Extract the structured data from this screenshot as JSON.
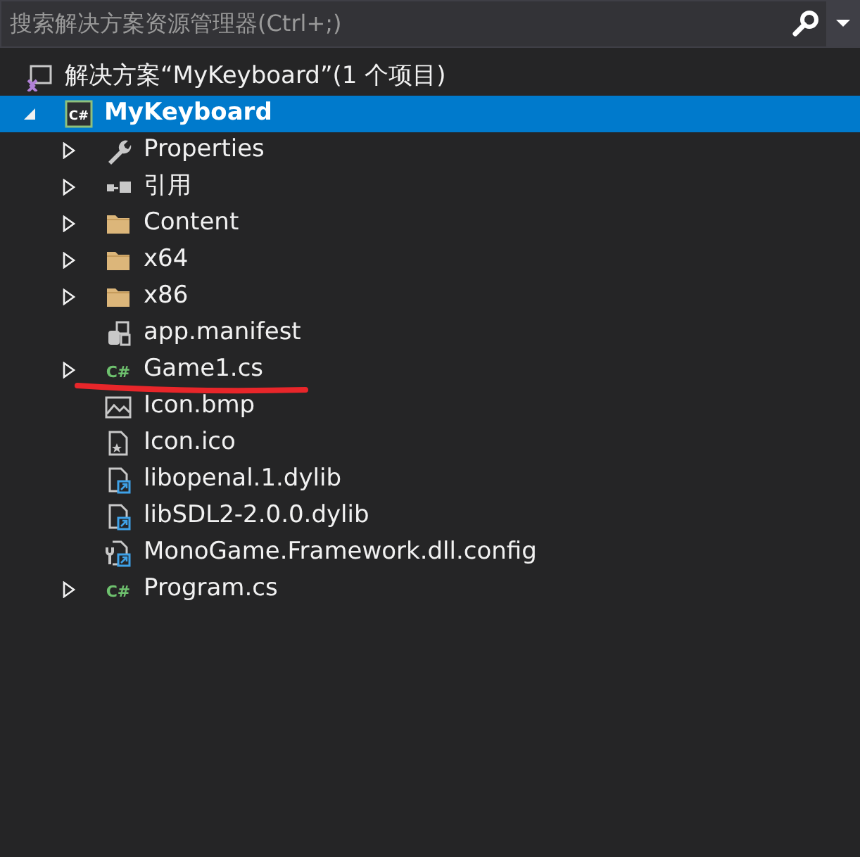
{
  "search": {
    "placeholder": "搜索解决方案资源管理器(Ctrl+;)"
  },
  "tree": [
    {
      "label": "解决方案“MyKeyboard”(1 个项目)",
      "kind": "solution",
      "selected": false,
      "children": [
        {
          "label": "MyKeyboard",
          "kind": "csproj",
          "icon_text": "C#",
          "expanded": true,
          "selected": true,
          "children": [
            {
              "label": "Properties",
              "kind": "wrench",
              "expanded": false,
              "selected": false
            },
            {
              "label": "引用",
              "kind": "reference",
              "expanded": false,
              "selected": false
            },
            {
              "label": "Content",
              "kind": "folder",
              "expanded": false,
              "selected": false
            },
            {
              "label": "x64",
              "kind": "folder",
              "expanded": false,
              "selected": false
            },
            {
              "label": "x86",
              "kind": "folder",
              "expanded": false,
              "selected": false
            },
            {
              "label": "app.manifest",
              "kind": "manifest",
              "selected": false
            },
            {
              "label": "Game1.cs",
              "kind": "csharp",
              "icon_text": "C#",
              "expanded": false,
              "selected": false,
              "underlined": true
            },
            {
              "label": "Icon.bmp",
              "kind": "image",
              "selected": false
            },
            {
              "label": "Icon.ico",
              "kind": "ico",
              "selected": false
            },
            {
              "label": "libopenal.1.dylib",
              "kind": "linkfile",
              "selected": false
            },
            {
              "label": "libSDL2-2.0.0.dylib",
              "kind": "linkfile",
              "selected": false
            },
            {
              "label": "MonoGame.Framework.dll.config",
              "kind": "config",
              "selected": false
            },
            {
              "label": "Program.cs",
              "kind": "csharp",
              "icon_text": "C#",
              "expanded": false,
              "selected": false
            }
          ]
        }
      ]
    }
  ]
}
